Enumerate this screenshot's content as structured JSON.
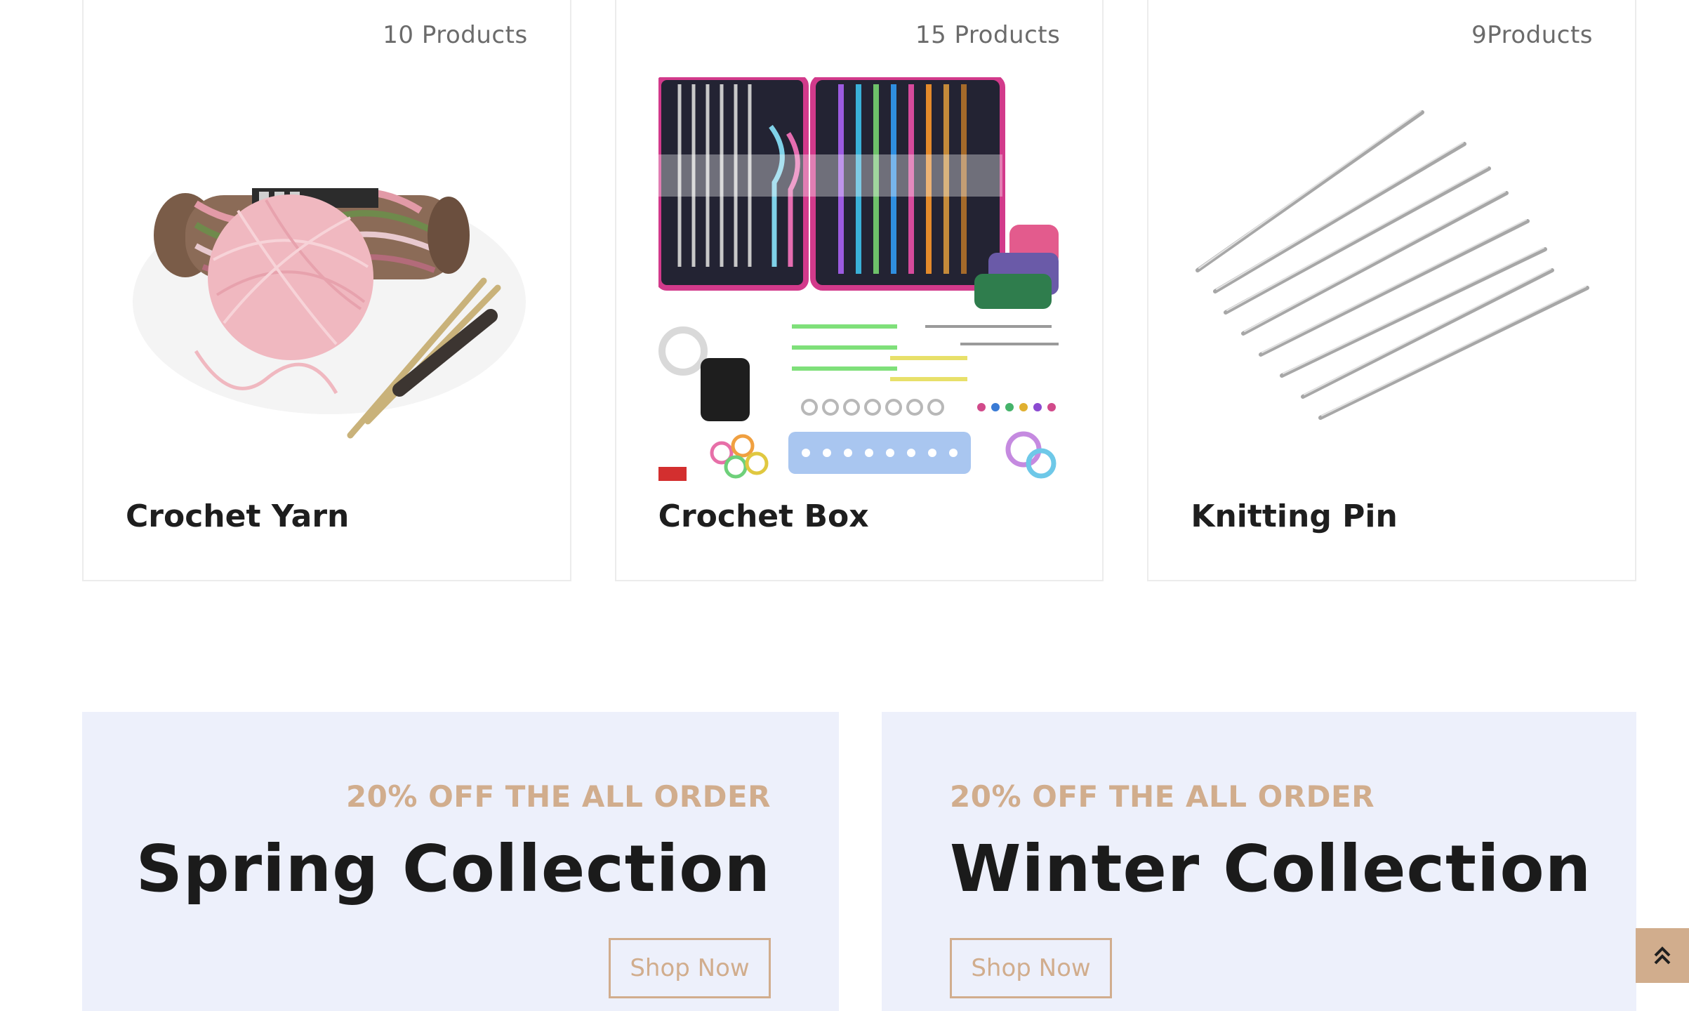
{
  "categories": [
    {
      "count": "10 Products",
      "title": "Crochet Yarn",
      "icon": "yarn-image"
    },
    {
      "count": "15 Products",
      "title": "Crochet Box",
      "icon": "crochet-kit-image"
    },
    {
      "count": "9Products",
      "title": "Knitting Pin",
      "icon": "knitting-pins-image"
    }
  ],
  "promos": [
    {
      "subtitle": "20% OFF THE ALL ORDER",
      "title": "Spring Collection",
      "button": "Shop Now"
    },
    {
      "subtitle": "20% OFF THE ALL ORDER",
      "title": "Winter Collection",
      "button": "Shop Now"
    }
  ],
  "scroll_top": {
    "icon": "double-chevron-up-icon"
  },
  "colors": {
    "accent": "#d1ad8d",
    "promo_bg": "#edf0fb",
    "card_border": "#ececec"
  }
}
